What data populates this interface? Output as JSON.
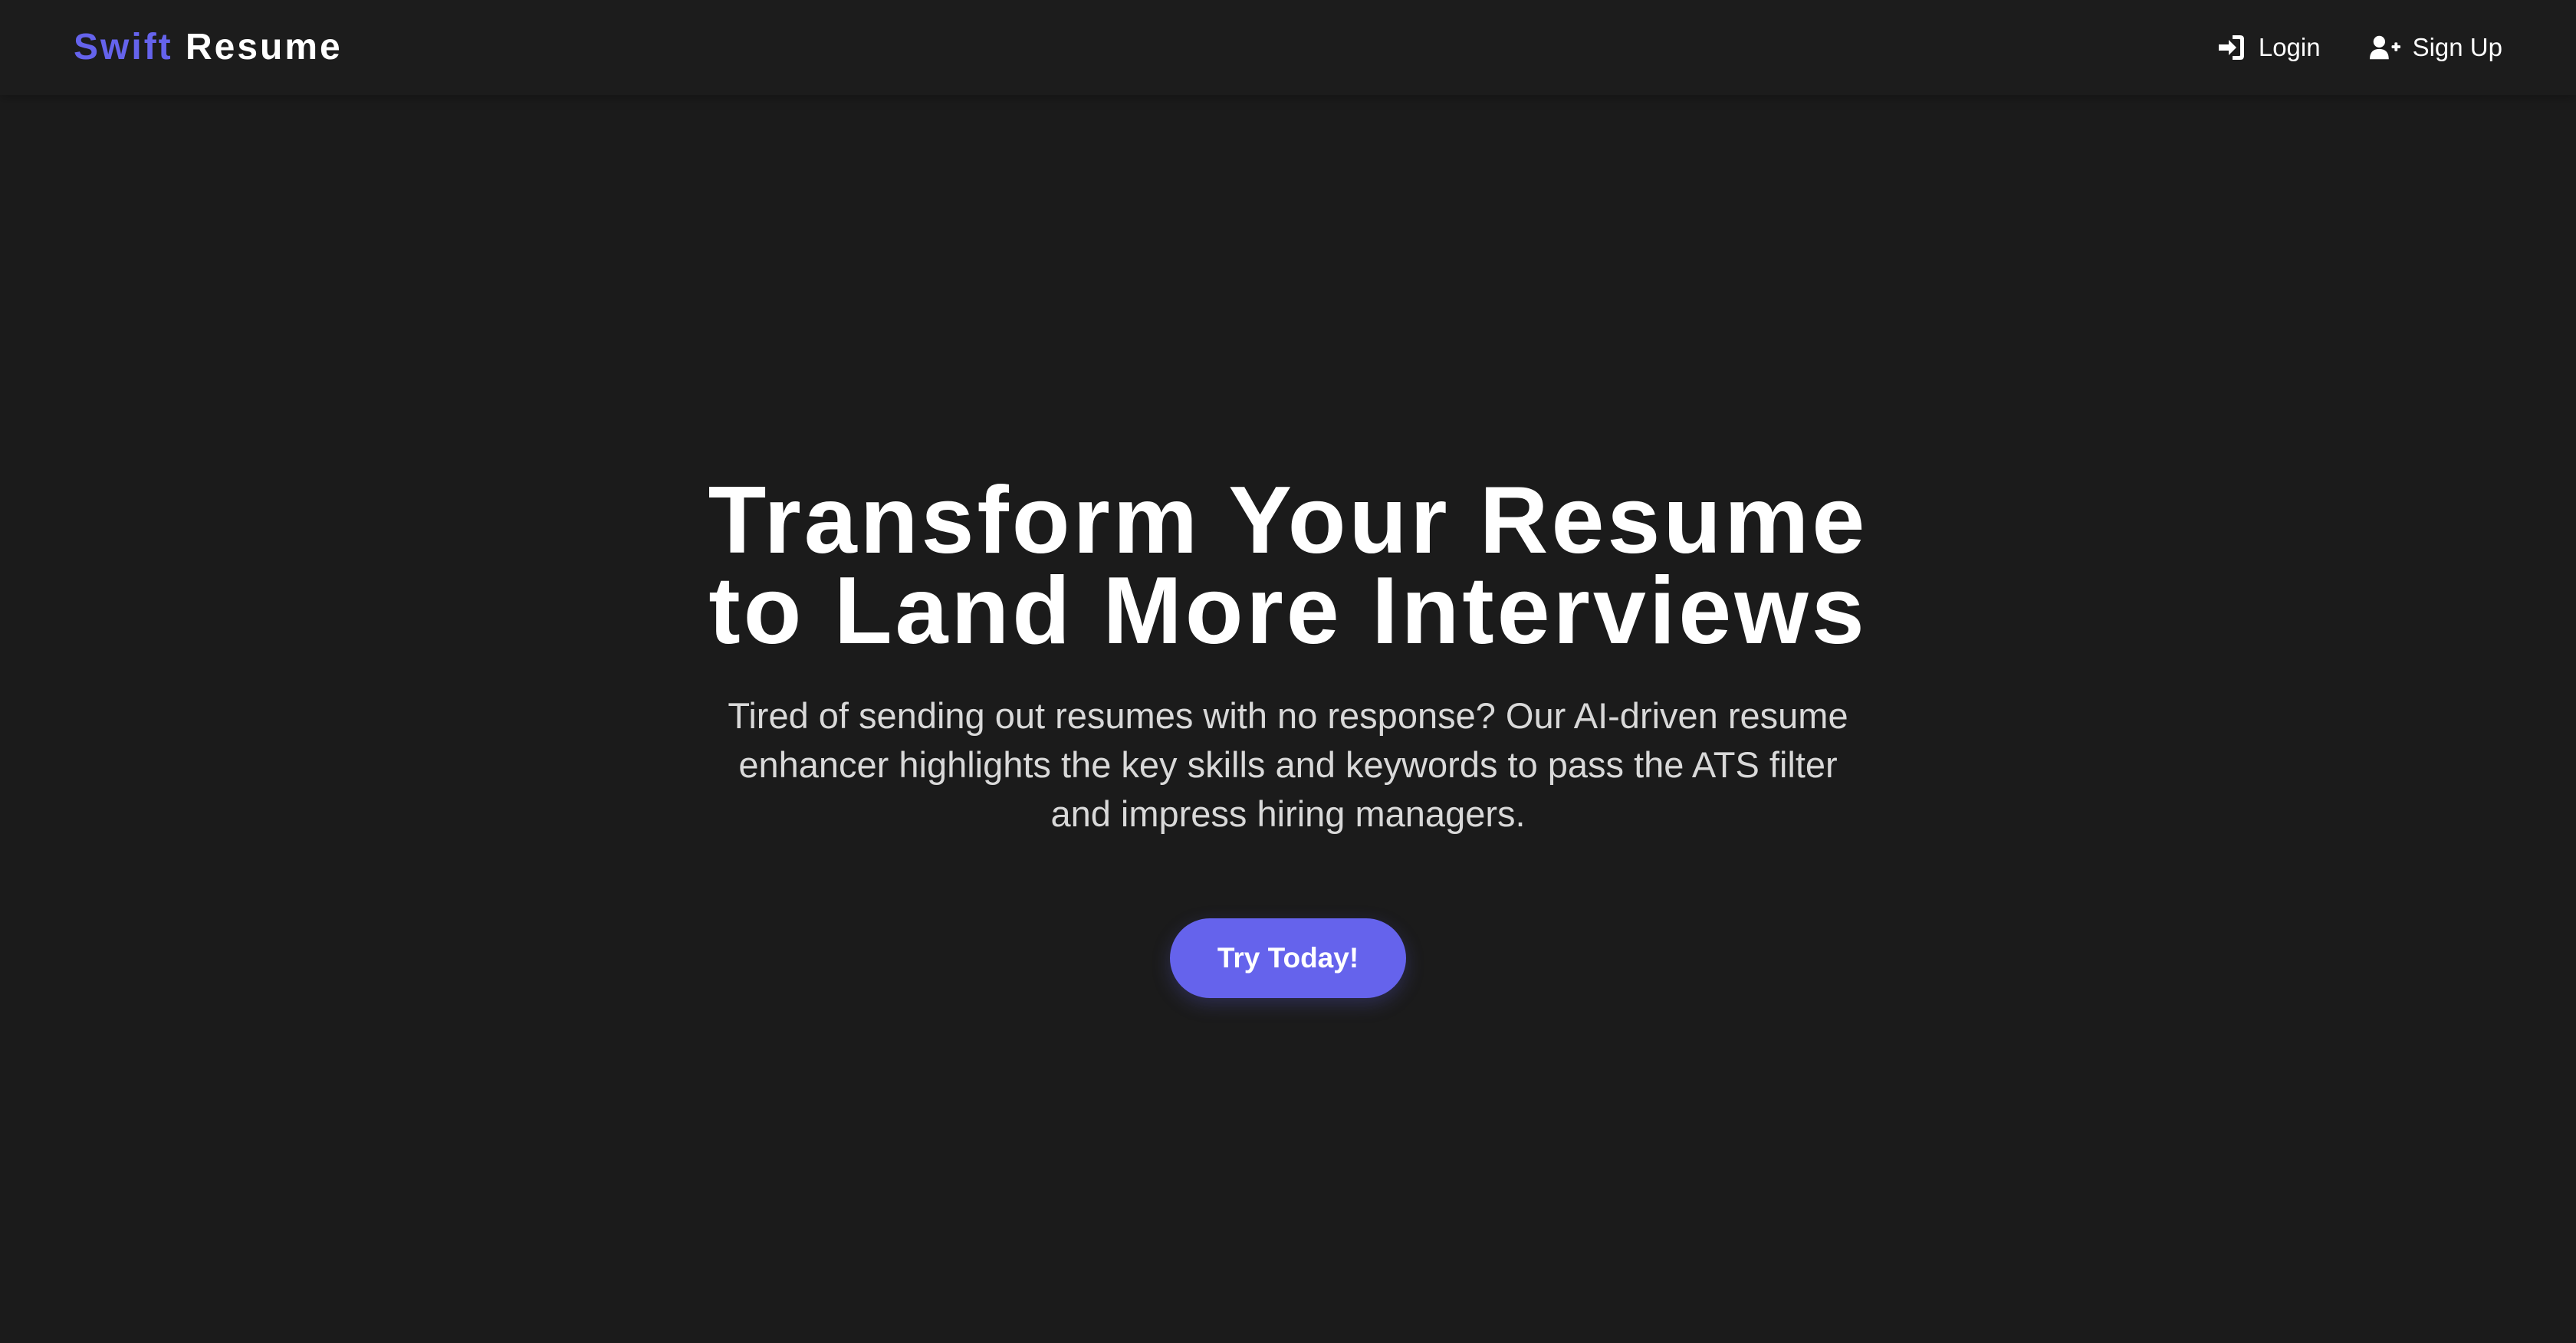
{
  "header": {
    "brand": {
      "accent": "Swift",
      "main": "Resume"
    },
    "nav": {
      "login": {
        "label": "Login",
        "icon": "sign-in-icon"
      },
      "signup": {
        "label": "Sign Up",
        "icon": "user-plus-icon"
      }
    }
  },
  "hero": {
    "title_line1": "Transform Your Resume",
    "title_line2": "to Land More Interviews",
    "subtitle": "Tired of sending out resumes with no response? Our AI-driven resume enhancer highlights the key skills and keywords to pass the ATS filter and impress hiring managers.",
    "cta_label": "Try Today!"
  },
  "colors": {
    "background": "#1b1b1b",
    "accent": "#6563ec",
    "text": "#ffffff",
    "muted_text": "#d9d9d9"
  }
}
